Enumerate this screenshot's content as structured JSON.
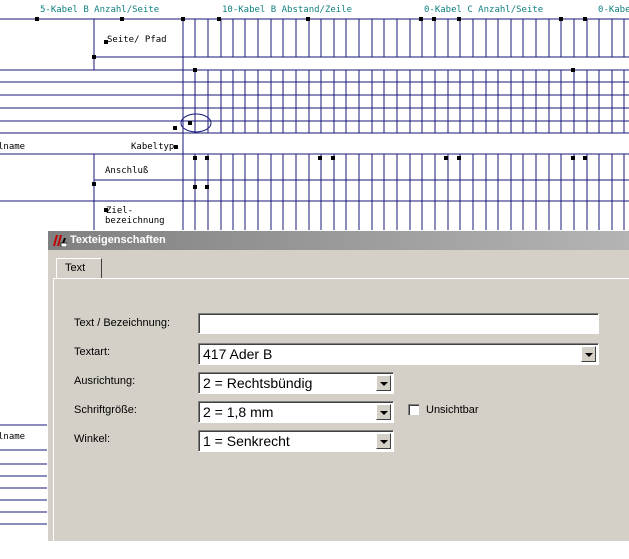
{
  "drawing": {
    "headers": [
      "5-Kabel B Anzahl/Seite",
      "10-Kabel B Abstand/Zeile",
      "0-Kabel C Anzahl/Seite",
      "0-Kabe"
    ],
    "labels": {
      "seite_pfad": "Seite/ Pfad",
      "name_left": "lname",
      "kabeltyp": "Kabeltyp",
      "anschluss": "Anschluß",
      "ziel_1": "Ziel-",
      "ziel_2": "bezeichnung",
      "name_left2": "lname"
    }
  },
  "dialog": {
    "title": "Texteigenschaften",
    "tab_label": "Text",
    "fields": {
      "text_label": "Text / Bezeichnung:",
      "text_value": "",
      "textart_label": "Textart:",
      "textart_value": "417 Ader B",
      "ausrichtung_label": "Ausrichtung:",
      "ausrichtung_value": "2 = Rechtsbündig",
      "schriftgroesse_label": "Schriftgröße:",
      "schriftgroesse_value": "2 = 1,8 mm",
      "winkel_label": "Winkel:",
      "winkel_value": "1 = Senkrecht",
      "unsichtbar_label": "Unsichtbar",
      "unsichtbar_checked": false
    }
  },
  "colors": {
    "grid": "#1a1a7a",
    "teal": "#0f7f7f",
    "dialog_bg": "#d4d0c8"
  }
}
